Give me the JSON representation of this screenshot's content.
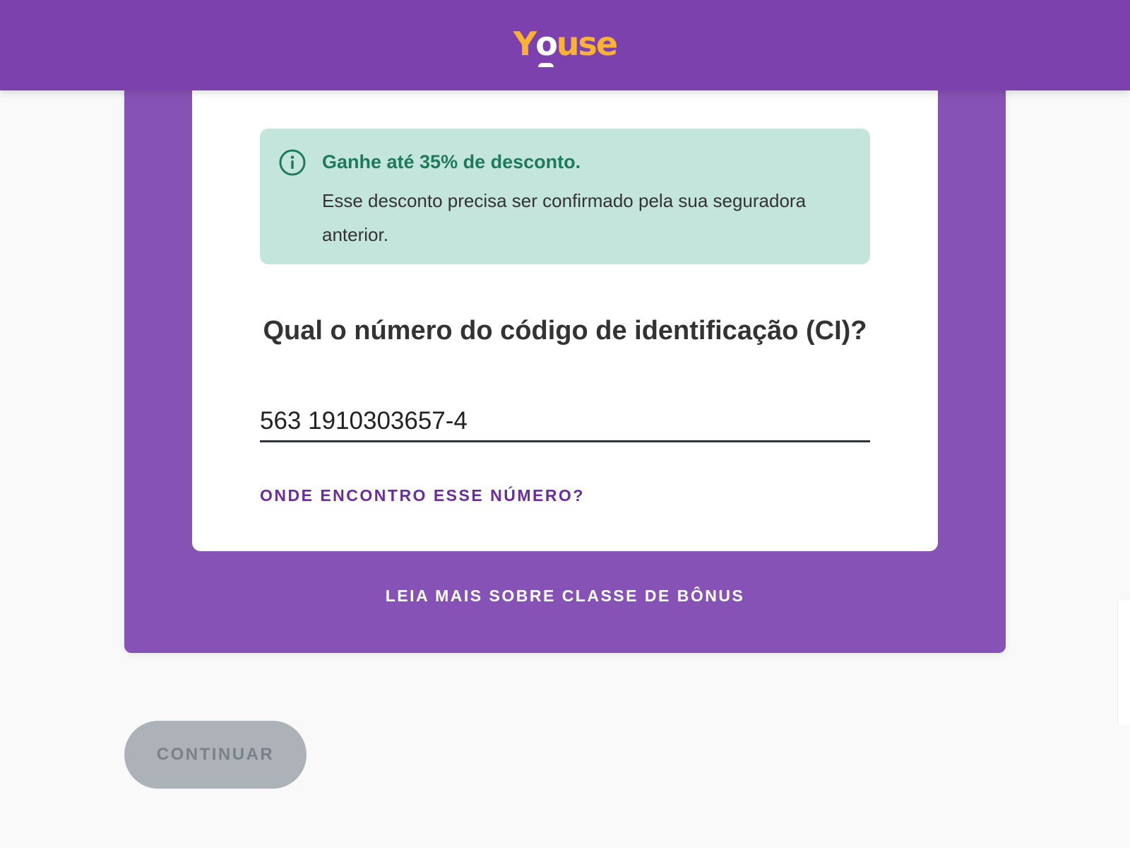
{
  "header": {
    "logo": {
      "prefix": "Y",
      "o": "o",
      "suffix": "use",
      "primary_color": "#f9b233",
      "accent_color": "#ffffff"
    },
    "background": "#7d41ad"
  },
  "alert": {
    "icon": "info-circle-icon",
    "title": "Ganhe até 35% de desconto.",
    "text": "Esse desconto precisa ser confirmado pela sua seguradora anterior.",
    "background": "#c3e5dc",
    "accent": "#1f7a5c"
  },
  "form": {
    "question": "Qual o número do código de identificação (CI)?",
    "ci_value": "563 1910303657-4",
    "help_link": "ONDE ENCONTRO ESSE NÚMERO?"
  },
  "bonus_link": "LEIA MAIS SOBRE CLASSE DE BÔNUS",
  "actions": {
    "continue_label": "CONTINUAR",
    "continue_disabled": true
  },
  "colors": {
    "brand_purple": "#7d41ad",
    "panel_purple": "#8752b5",
    "link_purple": "#6a2ca0",
    "disabled_button": "#adb2b8"
  }
}
